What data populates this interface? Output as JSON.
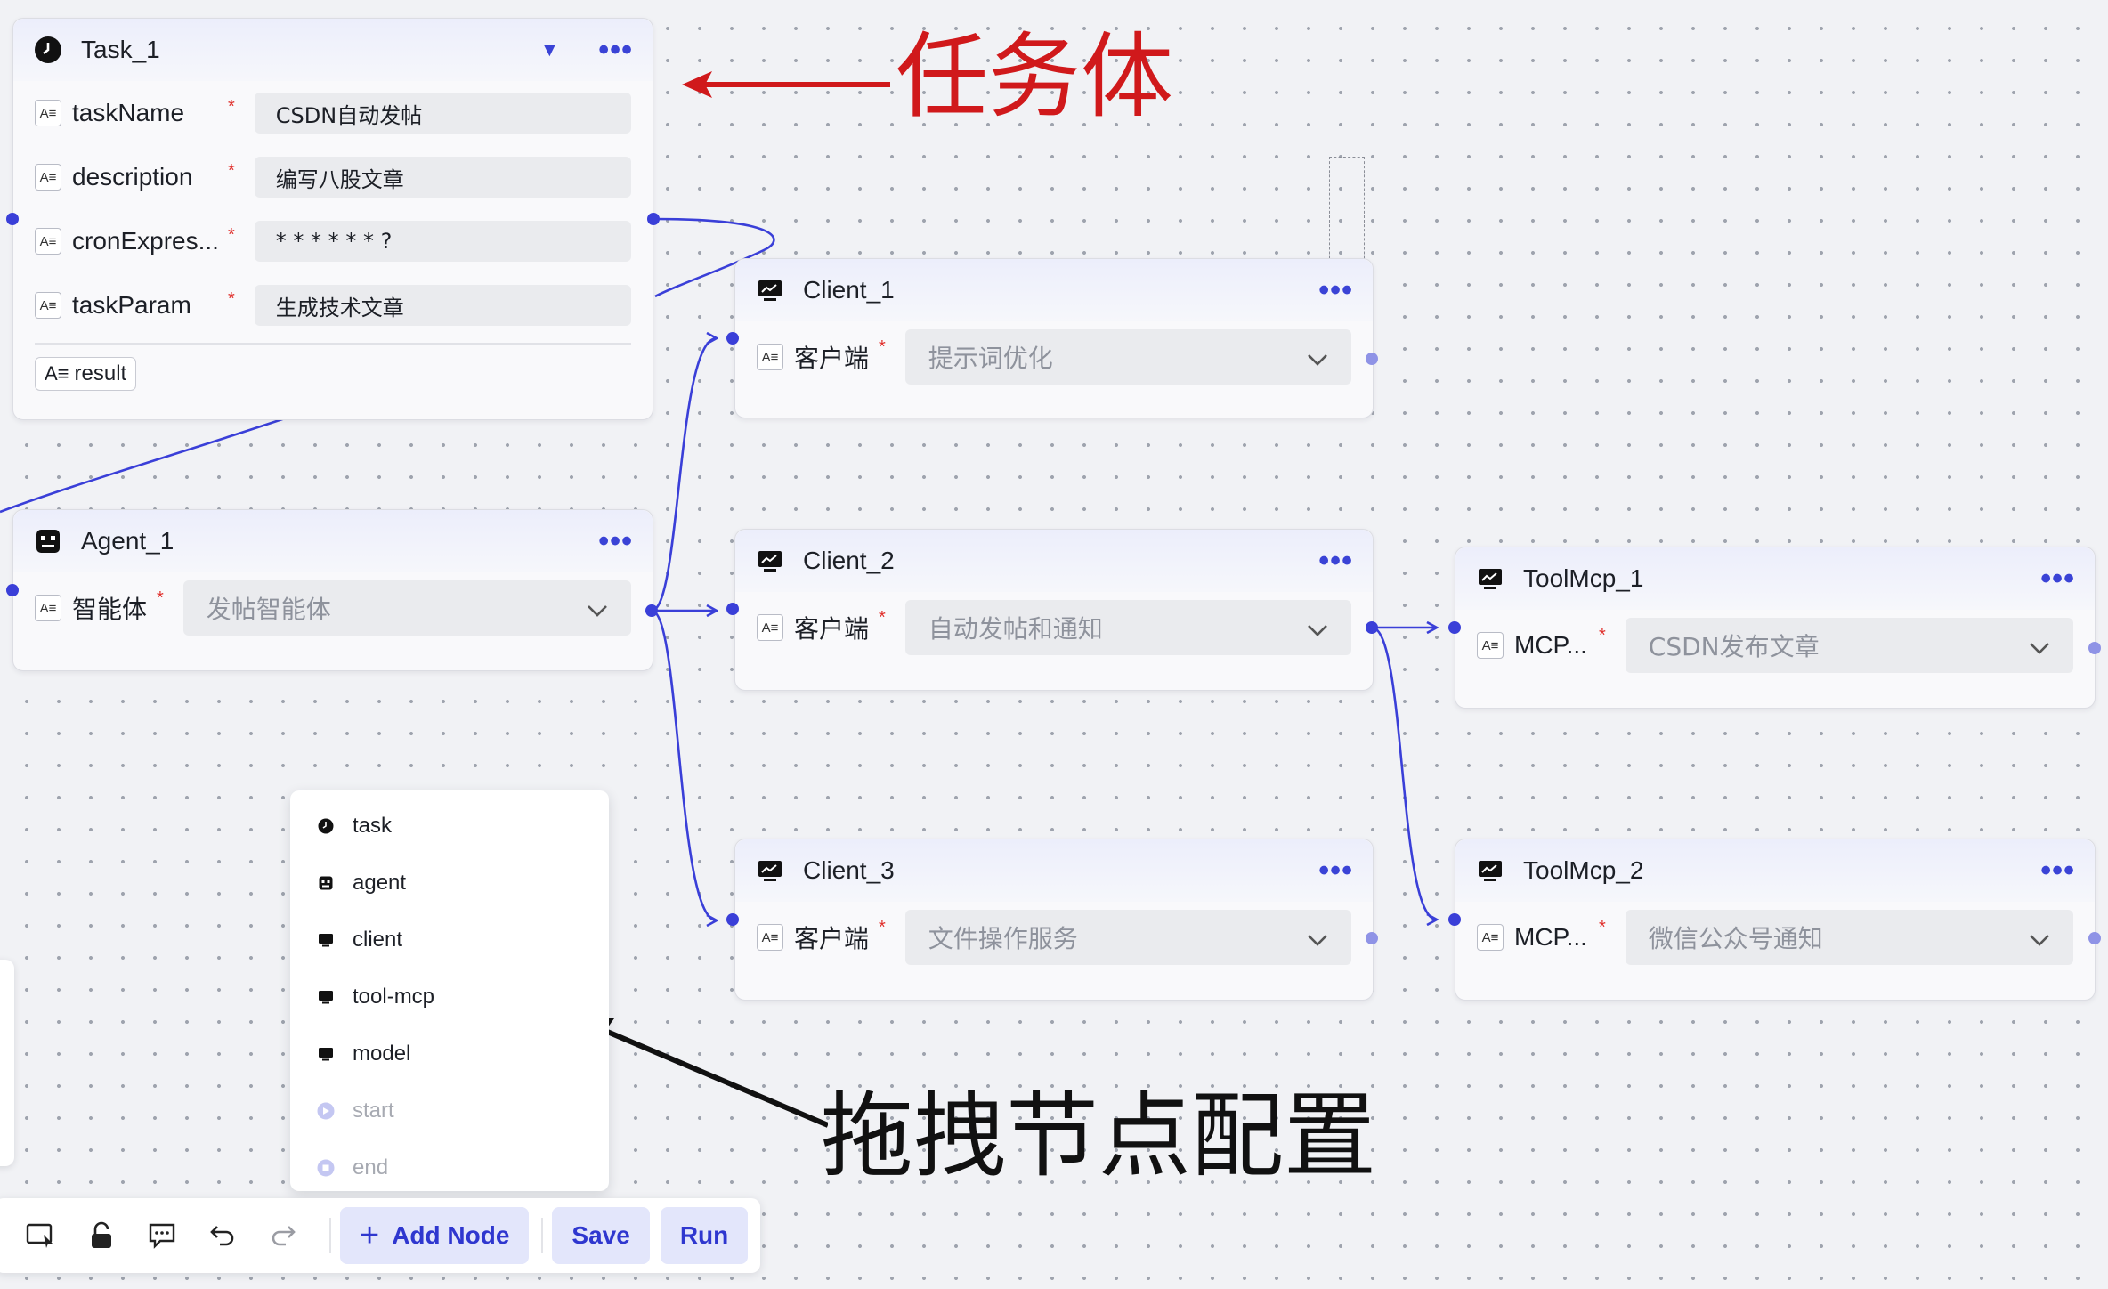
{
  "task_node": {
    "title": "Task_1",
    "fields": [
      {
        "label": "taskName",
        "value": "CSDN自动发帖"
      },
      {
        "label": "description",
        "value": "编写八股文章"
      },
      {
        "label": "cronExpres...",
        "value": "* * * * * * ?"
      },
      {
        "label": "taskParam",
        "value": "生成技术文章"
      }
    ],
    "output_label": "result"
  },
  "agent_node": {
    "title": "Agent_1",
    "field_label": "智能体",
    "selected": "发帖智能体"
  },
  "client_nodes": [
    {
      "title": "Client_1",
      "field_label": "客户端",
      "selected": "提示词优化"
    },
    {
      "title": "Client_2",
      "field_label": "客户端",
      "selected": "自动发帖和通知"
    },
    {
      "title": "Client_3",
      "field_label": "客户端",
      "selected": "文件操作服务"
    }
  ],
  "toolmcp_nodes": [
    {
      "title": "ToolMcp_1",
      "field_label": "MCP...",
      "selected": "CSDN发布文章"
    },
    {
      "title": "ToolMcp_2",
      "field_label": "MCP...",
      "selected": "微信公众号通知"
    }
  ],
  "node_menu": {
    "items": [
      {
        "label": "task",
        "icon": "clock-icon",
        "enabled": true
      },
      {
        "label": "agent",
        "icon": "robot-icon",
        "enabled": true
      },
      {
        "label": "client",
        "icon": "monitor-icon",
        "enabled": true
      },
      {
        "label": "tool-mcp",
        "icon": "monitor-icon",
        "enabled": true
      },
      {
        "label": "model",
        "icon": "monitor-icon",
        "enabled": true
      },
      {
        "label": "start",
        "icon": "start-icon",
        "enabled": false
      },
      {
        "label": "end",
        "icon": "end-icon",
        "enabled": false
      }
    ]
  },
  "toolbar": {
    "icons": [
      "pointer-select-icon",
      "unlock-icon",
      "comment-icon",
      "undo-icon",
      "redo-icon"
    ],
    "add_node_label": "Add Node",
    "save_label": "Save",
    "run_label": "Run"
  },
  "annotations": {
    "task_label": "任务体",
    "drag_label": "拖拽节点配置"
  },
  "colors": {
    "accent": "#3a3fd8",
    "annotation_red": "#d0191b",
    "annotation_black": "#111111",
    "required_star": "#e0302c"
  }
}
